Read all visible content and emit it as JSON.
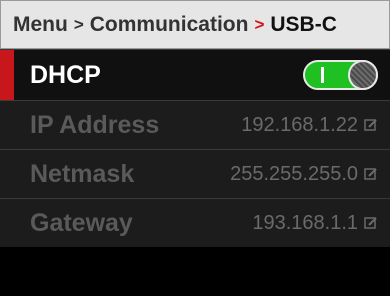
{
  "breadcrumb": {
    "items": [
      "Menu",
      "Communication"
    ],
    "current": "USB-C",
    "separator": ">"
  },
  "dhcp": {
    "label": "DHCP",
    "enabled": true
  },
  "fields": [
    {
      "label": "IP Address",
      "value": "192.168.1.22"
    },
    {
      "label": "Netmask",
      "value": "255.255.255.0"
    },
    {
      "label": "Gateway",
      "value": "193.168.1.1"
    }
  ],
  "colors": {
    "accent": "#c8161d",
    "toggle_on": "#1fc021",
    "header_bg": "#e6e6e6"
  },
  "icons": {
    "edit": "edit-pencil-icon",
    "toggle": "toggle-switch-icon"
  }
}
